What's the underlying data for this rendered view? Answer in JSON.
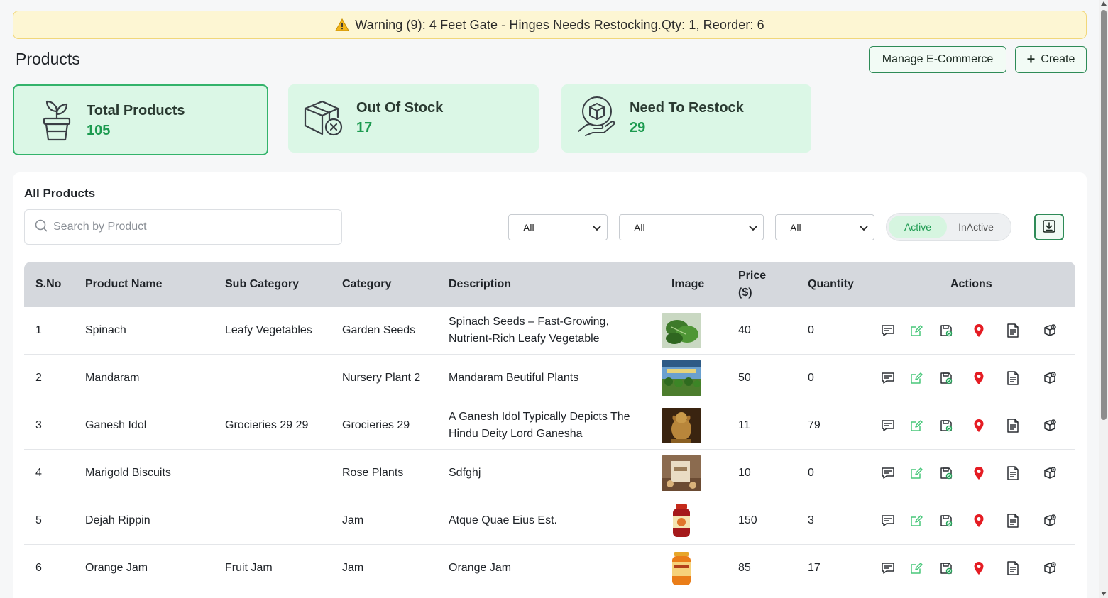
{
  "warning": {
    "text": "Warning (9): 4 Feet Gate - Hinges Needs Restocking.Qty: 1, Reorder: 6"
  },
  "header": {
    "title": "Products",
    "manage_label": "Manage E-Commerce",
    "create_label": "Create"
  },
  "stats": [
    {
      "label": "Total Products",
      "value": "105",
      "icon": "plant-pot-icon"
    },
    {
      "label": "Out Of Stock",
      "value": "17",
      "icon": "box-x-icon"
    },
    {
      "label": "Need To Restock",
      "value": "29",
      "icon": "hand-box-icon"
    }
  ],
  "panel": {
    "title": "All Products"
  },
  "search": {
    "placeholder": "Search by Product"
  },
  "filters": [
    {
      "selected": "All"
    },
    {
      "selected": "All"
    },
    {
      "selected": "All"
    }
  ],
  "status_toggle": {
    "active_label": "Active",
    "inactive_label": "InActive",
    "selected": "Active"
  },
  "table": {
    "headers": {
      "sno": "S.No",
      "name": "Product Name",
      "sub": "Sub Category",
      "cat": "Category",
      "desc": "Description",
      "img": "Image",
      "price": "Price ($)",
      "qty": "Quantity",
      "actions": "Actions"
    },
    "rows": [
      {
        "sno": "1",
        "name": "Spinach",
        "sub": "Leafy Vegetables",
        "cat": "Garden Seeds",
        "desc": "Spinach Seeds – Fast-Growing, Nutrient-Rich Leafy Vegetable",
        "price": "40",
        "qty": "0"
      },
      {
        "sno": "2",
        "name": "Mandaram",
        "sub": "",
        "cat": "Nursery Plant 2",
        "desc": "Mandaram Beutiful Plants",
        "price": "50",
        "qty": "0"
      },
      {
        "sno": "3",
        "name": "Ganesh Idol",
        "sub": "Grocieries 29 29",
        "cat": "Grocieries 29",
        "desc": "A Ganesh Idol Typically Depicts The Hindu Deity Lord Ganesha",
        "price": "11",
        "qty": "79"
      },
      {
        "sno": "4",
        "name": "Marigold Biscuits",
        "sub": "",
        "cat": "Rose Plants",
        "desc": "Sdfghj",
        "price": "10",
        "qty": "0"
      },
      {
        "sno": "5",
        "name": "Dejah Rippin",
        "sub": "",
        "cat": "Jam",
        "desc": "Atque Quae Eius Est.",
        "price": "150",
        "qty": "3"
      },
      {
        "sno": "6",
        "name": "Orange Jam",
        "sub": "Fruit Jam",
        "cat": "Jam",
        "desc": "Orange Jam",
        "price": "85",
        "qty": "17"
      }
    ]
  },
  "colors": {
    "accent": "#1d9b50",
    "card_bg": "#dbf7e6",
    "warning_bg": "#fdf6d3",
    "location_pin": "#e51c23"
  }
}
